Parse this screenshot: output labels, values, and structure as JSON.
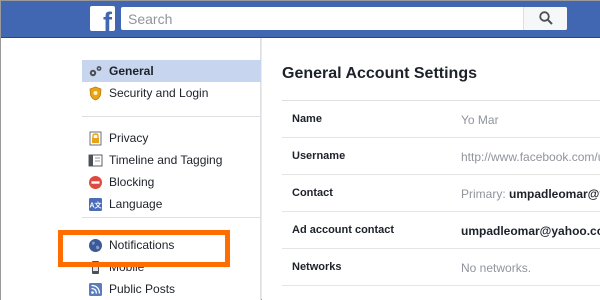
{
  "header": {
    "logo_letter": "f",
    "search": {
      "placeholder": "Search",
      "value": ""
    },
    "brand_color": "#4267b2"
  },
  "sidebar": {
    "groups": [
      {
        "items": [
          {
            "label": "General",
            "icon": "gears-icon",
            "active": true
          },
          {
            "label": "Security and Login",
            "icon": "shield-badge-icon",
            "active": false
          }
        ]
      },
      {
        "items": [
          {
            "label": "Privacy",
            "icon": "lock-icon",
            "active": false
          },
          {
            "label": "Timeline and Tagging",
            "icon": "timeline-icon",
            "active": false
          },
          {
            "label": "Blocking",
            "icon": "blocking-icon",
            "active": false
          },
          {
            "label": "Language",
            "icon": "language-icon",
            "active": false
          }
        ]
      },
      {
        "items": [
          {
            "label": "Notifications",
            "icon": "globe-icon",
            "active": false
          },
          {
            "label": "Mobile",
            "icon": "mobile-icon",
            "active": false
          },
          {
            "label": "Public Posts",
            "icon": "rss-icon",
            "active": false
          }
        ]
      }
    ]
  },
  "main": {
    "title": "General Account Settings",
    "rows": [
      {
        "label": "Name",
        "value_prefix": "",
        "value": "Yo Mar"
      },
      {
        "label": "Username",
        "value_prefix": "",
        "value": "http://www.facebook.com/umpadleomar"
      },
      {
        "label": "Contact",
        "value_prefix": "Primary: ",
        "value": "umpadleomar@yahoo.com"
      },
      {
        "label": "Ad account contact",
        "value_prefix": "",
        "value": "umpadleomar@yahoo.com"
      },
      {
        "label": "Networks",
        "value_prefix": "",
        "value": "No networks."
      }
    ]
  },
  "annotation": {
    "highlight_color": "#ff6d00",
    "highlighted_item": "Notifications"
  }
}
